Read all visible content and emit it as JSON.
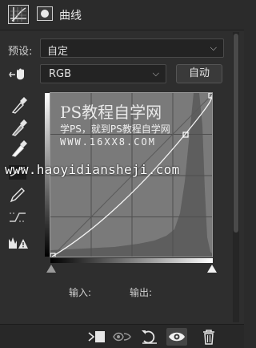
{
  "header": {
    "title": "曲线",
    "icons": [
      "curves-adjustment-icon",
      "mask-icon"
    ]
  },
  "preset": {
    "label": "预设:",
    "value": "自定"
  },
  "channel": {
    "value": "RGB",
    "auto_label": "自动"
  },
  "tools": [
    "targeted-adjust-hand-icon",
    "black-point-eyedropper-icon",
    "gray-point-eyedropper-icon",
    "white-point-eyedropper-icon",
    "edit-points-curve-icon",
    "pencil-draw-icon",
    "smooth-curve-icon",
    "clipping-warning-icon"
  ],
  "watermark": {
    "line1": "PS教程自学网",
    "line2": "学PS，就到PS教程自学网",
    "line3": "WWW.16XX8.COM",
    "url": "www.haoyidiansheji.com"
  },
  "io": {
    "input_label": "输入:",
    "output_label": "输出:"
  },
  "footer": {
    "icons": [
      "clip-to-layer-icon",
      "view-previous-state-icon",
      "reset-icon",
      "visibility-eye-icon",
      "delete-trash-icon"
    ]
  }
}
